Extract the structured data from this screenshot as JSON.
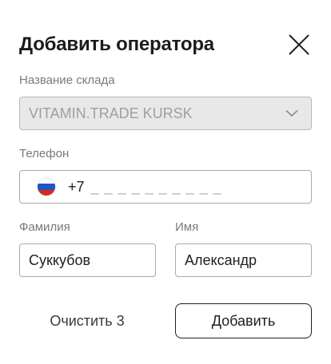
{
  "dialog": {
    "title": "Добавить оператора"
  },
  "warehouse": {
    "label": "Название склада",
    "value": "VITAMIN.TRADE KURSK"
  },
  "phone": {
    "label": "Телефон",
    "country_icon": "russia-flag-icon",
    "code": "+7",
    "mask": "_ _ _ _ _ _ _ _ _ _"
  },
  "surname": {
    "label": "Фамилия",
    "value": "Суккубов"
  },
  "name": {
    "label": "Имя",
    "value": "Александр"
  },
  "actions": {
    "clear_label": "Очистить 3",
    "add_label": "Добавить"
  },
  "colors": {
    "flag_white": "#ffffff",
    "flag_blue": "#1c57c5",
    "flag_red": "#d52b1e"
  }
}
